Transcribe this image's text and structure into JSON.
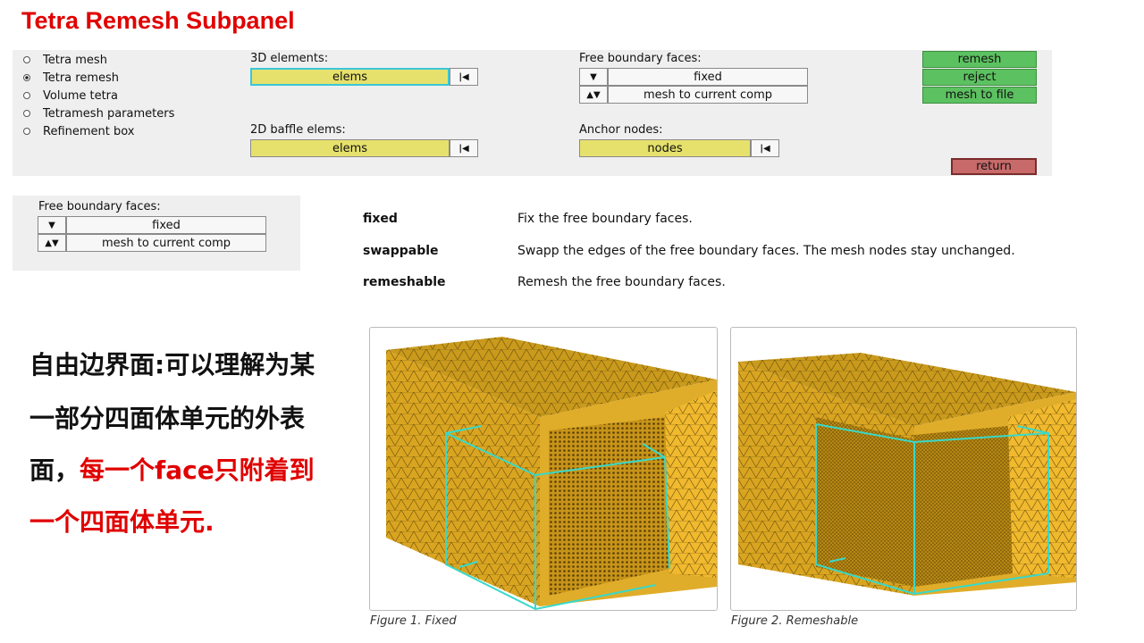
{
  "title": "Tetra Remesh Subpanel",
  "radios": [
    {
      "label": "Tetra mesh",
      "selected": false
    },
    {
      "label": "Tetra remesh",
      "selected": true
    },
    {
      "label": "Volume tetra",
      "selected": false
    },
    {
      "label": "Tetramesh parameters",
      "selected": false
    },
    {
      "label": "Refinement box",
      "selected": false
    }
  ],
  "elems3d": {
    "label": "3D elements:",
    "value": "elems"
  },
  "baffle": {
    "label": "2D baffle elems:",
    "value": "elems"
  },
  "free_boundary": {
    "label": "Free boundary faces:",
    "option": "fixed",
    "target": "mesh to current comp"
  },
  "anchor": {
    "label": "Anchor nodes:",
    "value": "nodes"
  },
  "actions": {
    "remesh": "remesh",
    "reject": "reject",
    "mesh_to_file": "mesh to file",
    "return": "return"
  },
  "small_panel": {
    "label": "Free boundary faces:",
    "option": "fixed",
    "target": "mesh to current comp"
  },
  "definitions": [
    {
      "term": "fixed",
      "desc": "Fix the free boundary faces."
    },
    {
      "term": "swappable",
      "desc": "Swapp the edges of the free boundary faces. The mesh nodes stay unchanged."
    },
    {
      "term": "remeshable",
      "desc": "Remesh the free boundary faces."
    }
  ],
  "chinese": {
    "line1": "自由边界面:可以理解为某",
    "line2": "一部分四面体单元的外表",
    "line3_black": "面，",
    "line3_red": "每一个face只附着到",
    "line4_red": "一个四面体单元."
  },
  "figures": [
    {
      "caption": "Figure 1. Fixed"
    },
    {
      "caption": "Figure 2. Remeshable"
    }
  ],
  "colors": {
    "title": "#e00000",
    "yellow_field": "#e6e16c",
    "green_button": "#5cc160",
    "return_button": "#c86a6a",
    "mesh": "#d9a521",
    "highlight": "#38d9c9"
  }
}
